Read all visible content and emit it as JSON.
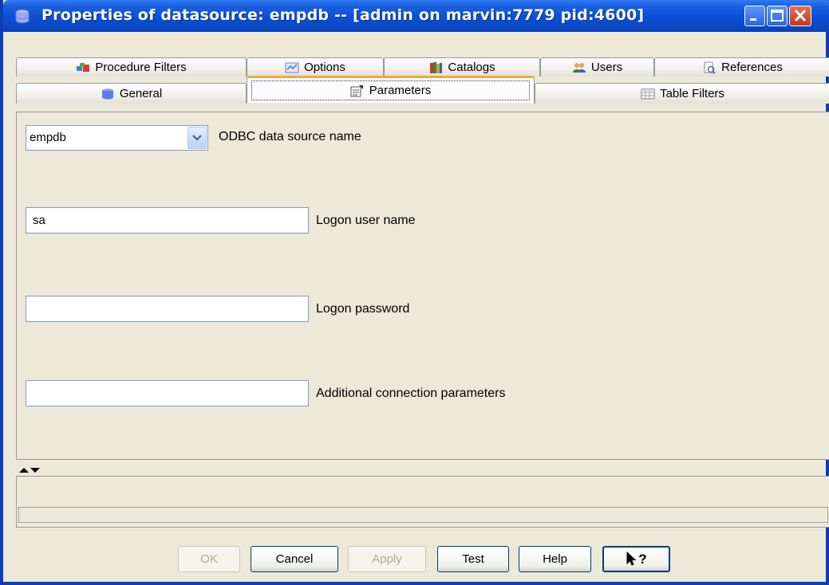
{
  "window": {
    "title": "Properties of datasource: empdb -- [admin on marvin:7779 pid:4600]"
  },
  "tabs": {
    "row1": [
      {
        "label": "Procedure Filters",
        "icon": "procedure-filters-icon"
      },
      {
        "label": "Options",
        "icon": "options-icon"
      },
      {
        "label": "Catalogs",
        "icon": "catalogs-icon"
      },
      {
        "label": "Users",
        "icon": "users-icon"
      },
      {
        "label": "References",
        "icon": "references-icon"
      }
    ],
    "row2": [
      {
        "label": "General",
        "icon": "database-icon"
      },
      {
        "label": "Parameters",
        "icon": "parameters-icon",
        "active": true
      },
      {
        "label": "Table Filters",
        "icon": "table-icon"
      }
    ]
  },
  "form": {
    "dsn": {
      "value": "empdb",
      "label": "ODBC data source name"
    },
    "user": {
      "value": "sa",
      "label": "Logon user name"
    },
    "password": {
      "value": "",
      "label": "Logon password"
    },
    "extra": {
      "value": "",
      "label": "Additional connection parameters"
    }
  },
  "buttons": {
    "ok": "OK",
    "cancel": "Cancel",
    "apply": "Apply",
    "test": "Test",
    "help": "Help",
    "whats_this": "?"
  }
}
